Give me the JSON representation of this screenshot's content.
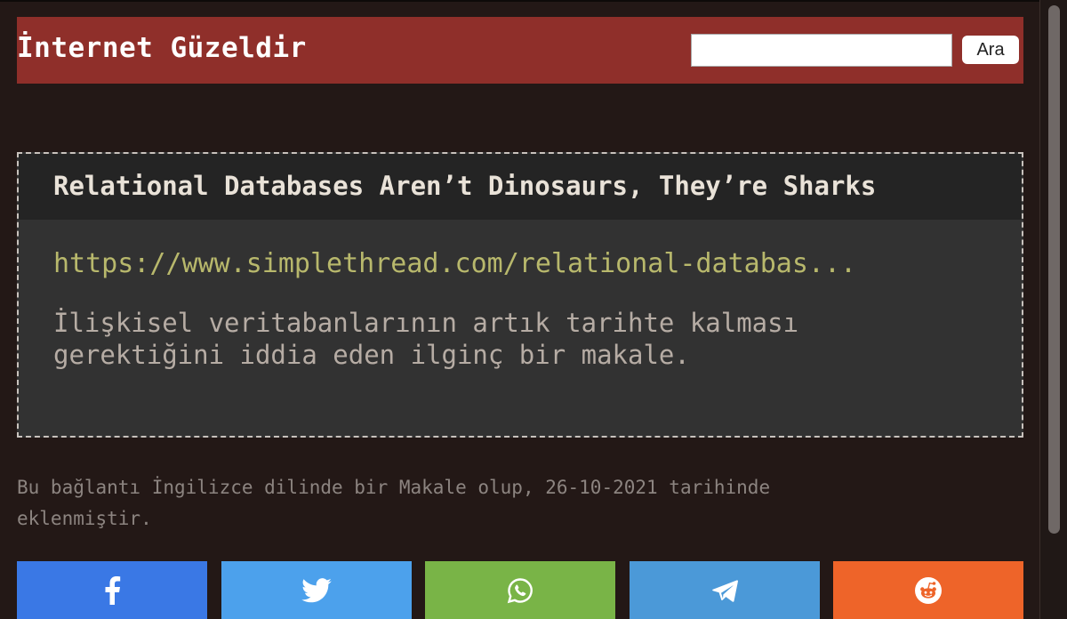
{
  "header": {
    "site_title": "İnternet Güzeldir",
    "search_placeholder": "",
    "search_button_label": "Ara"
  },
  "article": {
    "title": "Relational Databases Aren’t Dinosaurs, They’re Sharks",
    "link_text": "https://www.simplethread.com/relational-databas...",
    "description_line1": "İlişkisel veritabanlarının artık tarihte kalması",
    "description_line2": "gerektiğini iddia eden ilginç bir makale."
  },
  "meta": {
    "line1": "Bu bağlantı İngilizce dilinde bir Makale olup, 26-10-2021 tarihinde",
    "line2": "eklenmiştir."
  },
  "share": {
    "buttons": [
      {
        "name": "facebook",
        "icon": "facebook-icon",
        "color": "#3a78e5"
      },
      {
        "name": "twitter",
        "icon": "twitter-icon",
        "color": "#4ca1ec"
      },
      {
        "name": "whatsapp",
        "icon": "whatsapp-icon",
        "color": "#79b447"
      },
      {
        "name": "telegram",
        "icon": "telegram-icon",
        "color": "#4b99d8"
      },
      {
        "name": "reddit",
        "icon": "reddit-icon",
        "color": "#ee6429"
      }
    ]
  },
  "colors": {
    "background": "#231816",
    "header": "#8f2f2a",
    "card": "#323232",
    "card_header": "#242424",
    "link": "#b8b86c"
  }
}
